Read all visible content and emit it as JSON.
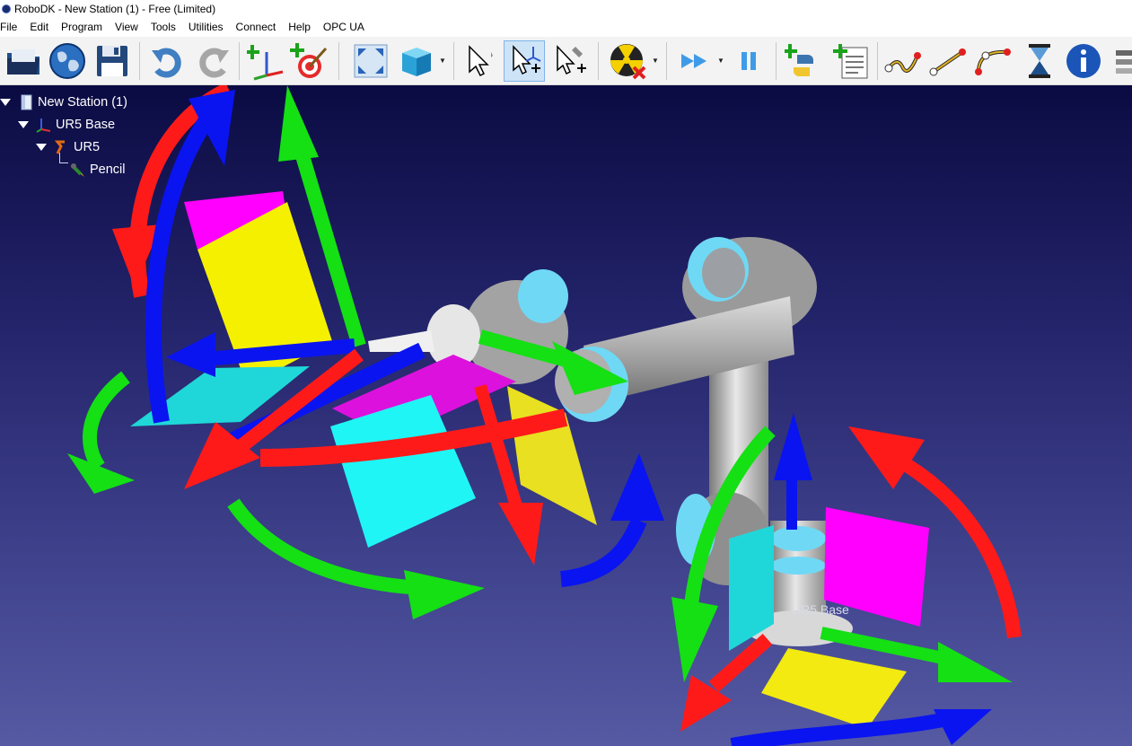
{
  "window": {
    "title": "RoboDK - New Station (1) - Free (Limited)"
  },
  "menu": [
    "File",
    "Edit",
    "Program",
    "View",
    "Tools",
    "Utilities",
    "Connect",
    "Help",
    "OPC UA"
  ],
  "toolbar": {
    "buttons": [
      "open-station-icon",
      "open-online-library-icon",
      "save-station-icon",
      "undo-icon",
      "redo-icon",
      "add-reference-frame-icon",
      "add-target-icon",
      "fit-all-icon",
      "view-cube-icon",
      "select-icon",
      "move-reference-icon",
      "move-tool-icon",
      "collision-check-icon",
      "fast-simulation-icon",
      "pause-simulation-icon",
      "add-python-program-icon",
      "add-program-icon",
      "joint-move-icon",
      "linear-move-icon",
      "circular-move-icon",
      "pause-instruction-icon",
      "info-icon",
      "set-output-icon"
    ],
    "active": "move-reference-icon"
  },
  "tree": {
    "station": "New Station (1)",
    "base": "UR5 Base",
    "robot": "UR5",
    "tool": "Pencil"
  },
  "viewport": {
    "base_label": "UR5 Base"
  },
  "colors": {
    "axis_x": "#ff0000",
    "axis_y": "#00e000",
    "axis_z": "#0000ff",
    "plane_xy": "#ffff00",
    "plane_yz": "#00ffff",
    "plane_xz": "#ff00ff",
    "robot_gray": "#a8a8a8",
    "robot_accent": "#6fd8f5"
  }
}
